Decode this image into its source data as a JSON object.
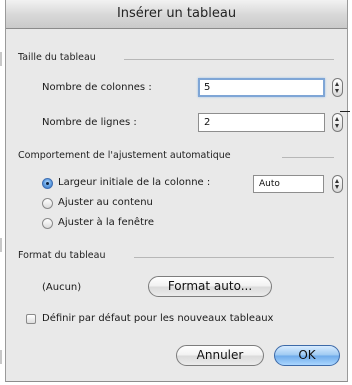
{
  "window": {
    "title": "Insérer un tableau"
  },
  "table_size": {
    "section_title": "Taille du tableau",
    "columns_label": "Nombre de colonnes :",
    "columns_value": "5",
    "rows_label": "Nombre de lignes :",
    "rows_value": "2"
  },
  "autofit": {
    "section_title": "Comportement de l'ajustement automatique",
    "options": [
      {
        "label": "Largeur initiale de la colonne :",
        "selected": true
      },
      {
        "label": "Ajuster au contenu",
        "selected": false
      },
      {
        "label": "Ajuster à la fenêtre",
        "selected": false
      }
    ],
    "initial_width_value": "Auto"
  },
  "table_format": {
    "section_title": "Format du tableau",
    "current_format": "(Aucun)",
    "auto_format_button": "Format auto..."
  },
  "default_checkbox": {
    "label": "Définir par défaut pour les nouveaux tableaux",
    "checked": false
  },
  "buttons": {
    "cancel": "Annuler",
    "ok": "OK"
  },
  "colors": {
    "focus_ring": "#7fa6d6",
    "default_button": "#6eaaea",
    "radio_selected": "#2f6fc0"
  }
}
